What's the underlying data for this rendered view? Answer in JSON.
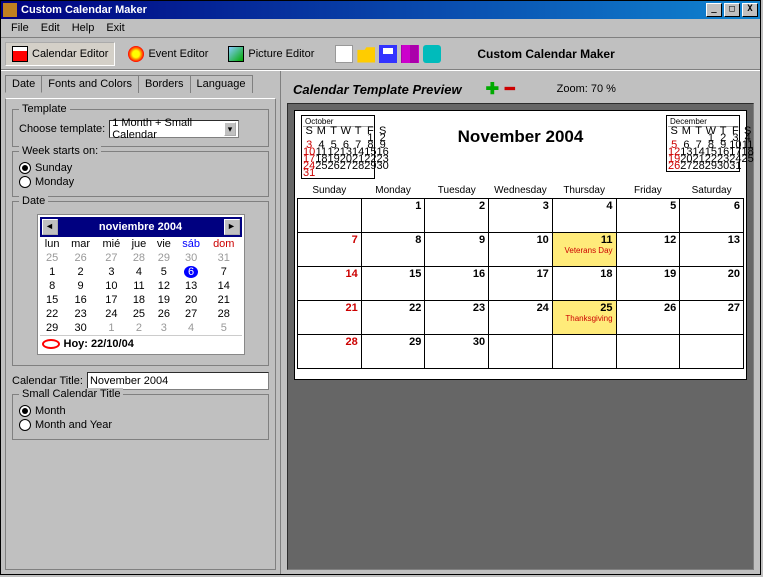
{
  "window": {
    "title": "Custom Calendar Maker"
  },
  "menu": [
    "File",
    "Edit",
    "Help",
    "Exit"
  ],
  "toolbar": {
    "calendar_editor": "Calendar Editor",
    "event_editor": "Event Editor",
    "picture_editor": "Picture Editor",
    "brand": "Custom Calendar Maker"
  },
  "tabs": {
    "date": "Date",
    "fonts": "Fonts and Colors",
    "borders": "Borders",
    "language": "Language"
  },
  "template": {
    "legend": "Template",
    "choose_label": "Choose template:",
    "value": "1 Month + Small Calendar"
  },
  "week": {
    "legend": "Week starts on:",
    "sunday": "Sunday",
    "monday": "Monday"
  },
  "datebox": {
    "legend": "Date"
  },
  "minical": {
    "month": "noviembre 2004",
    "days": [
      "lun",
      "mar",
      "mié",
      "jue",
      "vie",
      "sáb",
      "dom"
    ],
    "rows": [
      [
        "25",
        "26",
        "27",
        "28",
        "29",
        "30",
        "31"
      ],
      [
        "1",
        "2",
        "3",
        "4",
        "5",
        "6",
        "7"
      ],
      [
        "8",
        "9",
        "10",
        "11",
        "12",
        "13",
        "14"
      ],
      [
        "15",
        "16",
        "17",
        "18",
        "19",
        "20",
        "21"
      ],
      [
        "22",
        "23",
        "24",
        "25",
        "26",
        "27",
        "28"
      ],
      [
        "29",
        "30",
        "1",
        "2",
        "3",
        "4",
        "5"
      ]
    ],
    "today_cell": "6",
    "today_label": "Hoy: 22/10/04"
  },
  "cal_title": {
    "label": "Calendar Title:",
    "value": "November 2004"
  },
  "small_title": {
    "legend": "Small Calendar Title",
    "month": "Month",
    "month_year": "Month and Year"
  },
  "preview": {
    "title": "Calendar Template Preview",
    "zoom_label": "Zoom: 70 %",
    "tiny_left": {
      "month": "October",
      "header": [
        "S",
        "M",
        "T",
        "W",
        "T",
        "F",
        "S"
      ],
      "rows": [
        [
          "",
          "",
          "",
          "",
          "",
          "1",
          "2"
        ],
        [
          "3",
          "4",
          "5",
          "6",
          "7",
          "8",
          "9"
        ],
        [
          "10",
          "11",
          "12",
          "13",
          "14",
          "15",
          "16"
        ],
        [
          "17",
          "18",
          "19",
          "20",
          "21",
          "22",
          "23"
        ],
        [
          "24",
          "25",
          "26",
          "27",
          "28",
          "29",
          "30"
        ],
        [
          "31",
          "",
          "",
          "",
          "",
          "",
          ""
        ]
      ]
    },
    "tiny_right": {
      "month": "December",
      "header": [
        "S",
        "M",
        "T",
        "W",
        "T",
        "F",
        "S"
      ],
      "rows": [
        [
          "",
          "",
          "",
          "1",
          "2",
          "3",
          "4"
        ],
        [
          "5",
          "6",
          "7",
          "8",
          "9",
          "10",
          "11"
        ],
        [
          "12",
          "13",
          "14",
          "15",
          "16",
          "17",
          "18"
        ],
        [
          "19",
          "20",
          "21",
          "22",
          "23",
          "24",
          "25"
        ],
        [
          "26",
          "27",
          "28",
          "29",
          "30",
          "31",
          ""
        ]
      ]
    },
    "big_month": "November 2004",
    "big_days": [
      "Sunday",
      "Monday",
      "Tuesday",
      "Wednesday",
      "Thursday",
      "Friday",
      "Saturday"
    ],
    "big_rows": [
      [
        {
          "n": ""
        },
        {
          "n": "1"
        },
        {
          "n": "2"
        },
        {
          "n": "3"
        },
        {
          "n": "4"
        },
        {
          "n": "5"
        },
        {
          "n": "6"
        }
      ],
      [
        {
          "n": "7",
          "sun": true
        },
        {
          "n": "8"
        },
        {
          "n": "9"
        },
        {
          "n": "10"
        },
        {
          "n": "11",
          "event": "Veterans Day"
        },
        {
          "n": "12"
        },
        {
          "n": "13"
        }
      ],
      [
        {
          "n": "14",
          "sun": true
        },
        {
          "n": "15"
        },
        {
          "n": "16"
        },
        {
          "n": "17"
        },
        {
          "n": "18"
        },
        {
          "n": "19"
        },
        {
          "n": "20"
        }
      ],
      [
        {
          "n": "21",
          "sun": true
        },
        {
          "n": "22"
        },
        {
          "n": "23"
        },
        {
          "n": "24"
        },
        {
          "n": "25",
          "event": "Thanksgiving"
        },
        {
          "n": "26"
        },
        {
          "n": "27"
        }
      ],
      [
        {
          "n": "28",
          "sun": true
        },
        {
          "n": "29"
        },
        {
          "n": "30"
        },
        {
          "n": ""
        },
        {
          "n": ""
        },
        {
          "n": ""
        },
        {
          "n": ""
        }
      ]
    ]
  }
}
